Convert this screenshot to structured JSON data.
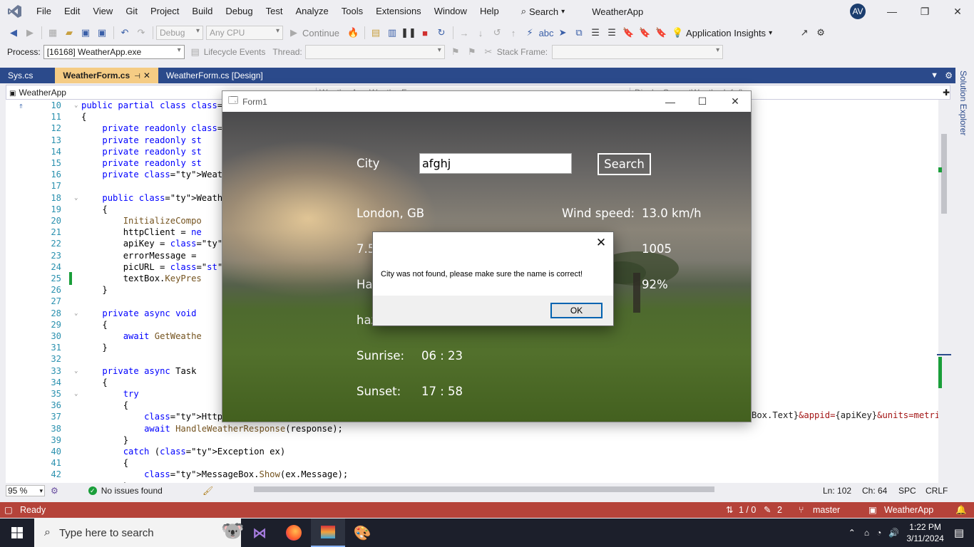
{
  "window": {
    "solution_name": "WeatherApp",
    "avatar_initials": "AV",
    "search_label": "Search"
  },
  "menu": [
    "File",
    "Edit",
    "View",
    "Git",
    "Project",
    "Build",
    "Debug",
    "Test",
    "Analyze",
    "Tools",
    "Extensions",
    "Window",
    "Help"
  ],
  "toolbar": {
    "config": "Debug",
    "platform": "Any CPU",
    "continue_label": "Continue",
    "app_insights": "Application Insights"
  },
  "debug_bar": {
    "process_label": "Process:",
    "process_value": "[16168] WeatherApp.exe",
    "lifecycle_label": "Lifecycle Events",
    "thread_label": "Thread:",
    "stack_frame_label": "Stack Frame:"
  },
  "tabs": [
    {
      "label": "Sys.cs"
    },
    {
      "label": "WeatherForm.cs"
    },
    {
      "label": "WeatherForm.cs [Design]"
    }
  ],
  "side_panel": "Solution Explorer",
  "navbar": {
    "project": "WeatherApp",
    "class": "WeatherApp.WeatherForm",
    "member": "DisplayCurrentWeatherInfo()"
  },
  "code": [
    {
      "n": "10",
      "t": "public partial class We"
    },
    {
      "n": "11",
      "t": "{"
    },
    {
      "n": "12",
      "t": "    private readonly Ht"
    },
    {
      "n": "13",
      "t": "    private readonly st"
    },
    {
      "n": "14",
      "t": "    private readonly st"
    },
    {
      "n": "15",
      "t": "    private readonly st"
    },
    {
      "n": "16",
      "t": "    private WeatherInfo"
    },
    {
      "n": "17",
      "t": ""
    },
    {
      "n": "18",
      "t": "    public WeatherForm("
    },
    {
      "n": "19",
      "t": "    {"
    },
    {
      "n": "20",
      "t": "        InitializeCompo"
    },
    {
      "n": "21",
      "t": "        httpClient = ne"
    },
    {
      "n": "22",
      "t": "        apiKey = File.R"
    },
    {
      "n": "23",
      "t": "        errorMessage = "
    },
    {
      "n": "24",
      "t": "        picURL = \"http:"
    },
    {
      "n": "25",
      "t": "        textBox.KeyPres"
    },
    {
      "n": "26",
      "t": "    }"
    },
    {
      "n": "27",
      "t": ""
    },
    {
      "n": "28",
      "t": "    private async void "
    },
    {
      "n": "29",
      "t": "    {"
    },
    {
      "n": "30",
      "t": "        await GetWeathe"
    },
    {
      "n": "31",
      "t": "    }"
    },
    {
      "n": "32",
      "t": ""
    },
    {
      "n": "33",
      "t": "    private async Task "
    },
    {
      "n": "34",
      "t": "    {"
    },
    {
      "n": "35",
      "t": "        try"
    },
    {
      "n": "36",
      "t": "        {"
    },
    {
      "n": "37",
      "t": "            HttpRespons"
    },
    {
      "n": "38",
      "t": "            await HandleWeatherResponse(response);"
    },
    {
      "n": "39",
      "t": "        }"
    },
    {
      "n": "40",
      "t": "        catch (Exception ex)"
    },
    {
      "n": "41",
      "t": "        {"
    },
    {
      "n": "42",
      "t": "            MessageBox.Show(ex.Message);"
    },
    {
      "n": "43",
      "t": "        }"
    }
  ],
  "code_tail": "Box.Text}&appid={apiKey}&units=metri",
  "editor_status": {
    "zoom": "95 %",
    "issues": "No issues found",
    "ln": "Ln: 102",
    "ch": "Ch: 64",
    "spc": "SPC",
    "crlf": "CRLF"
  },
  "statusbar": {
    "ready": "Ready",
    "counts": "1 / 0",
    "edits": "2",
    "branch": "master",
    "repo": "WeatherApp"
  },
  "taskbar": {
    "search_placeholder": "Type here to search",
    "time": "1:22 PM",
    "date": "3/11/2024"
  },
  "form1": {
    "title": "Form1",
    "city_label": "City",
    "city_value": "afghj",
    "search_button": "Search",
    "location": "London, GB",
    "wind_label": "Wind speed:",
    "wind_value": "13.0 km/h",
    "temp_partial": "7.5",
    "pressure_value": "1005",
    "desc_partial": "Ha",
    "humidity_value": "92%",
    "detail_partial": "haz",
    "sunrise_label": "Sunrise:",
    "sunrise_value": "06 : 23",
    "sunset_label": "Sunset:",
    "sunset_value": "17 : 58"
  },
  "msgbox": {
    "message": "City was not found, please make sure the name is correct!",
    "ok_label": "OK"
  }
}
